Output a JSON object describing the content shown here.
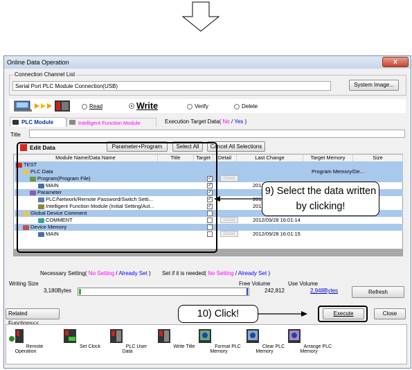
{
  "window": {
    "title": "Online Data Operation",
    "close_glyph": "x"
  },
  "connection": {
    "group_label": "Connection Channel List",
    "value": "Serial Port  PLC Module Connection(USB)",
    "system_image_label": "System Image..."
  },
  "operations": {
    "read": "Read",
    "write": "Write",
    "verify": "Verify",
    "delete": "Delete",
    "selected": "write"
  },
  "tabs": [
    {
      "label": "PLC Module"
    },
    {
      "label": "Intelligent Function Module"
    }
  ],
  "execution_target": {
    "label": "Execution Target Data(",
    "no": "No",
    "slash": "/",
    "yes": "Yes",
    "close": ")"
  },
  "title_field": {
    "label": "Title",
    "value": ""
  },
  "edit_data": {
    "label": "Edit Data",
    "param_program_btn": "Parameter+Program",
    "select_all_btn": "Select All",
    "cancel_btn": "Cancel All Selections"
  },
  "table": {
    "headers": [
      "Module Name/Data Name",
      "Title",
      "Target",
      "Detail",
      "Last Change",
      "Target Memory",
      "Size"
    ],
    "rows": [
      {
        "name": "TEST",
        "checked": false,
        "detail": "",
        "date": "",
        "memory": "",
        "blue": true
      },
      {
        "name": "PLC Data",
        "checked": false,
        "detail": "",
        "date": "",
        "memory": "Program Memory/De...",
        "blue": true
      },
      {
        "name": "Program(Program File)",
        "checked": true,
        "detail": "Detail",
        "date": "",
        "memory": "",
        "blue": true
      },
      {
        "name": "MAIN",
        "checked": true,
        "detail": "",
        "date": "2012/",
        "memory": "",
        "blue": false
      },
      {
        "name": "Parameter",
        "checked": true,
        "detail": "",
        "date": "",
        "memory": "",
        "blue": true
      },
      {
        "name": "PLC/Network/Remote Password/Switch Setti...",
        "checked": true,
        "detail": "",
        "date": "2012/",
        "memory": "",
        "blue": false
      },
      {
        "name": "Intelligent Function Module (Initial Setting/Aut...",
        "checked": true,
        "detail": "",
        "date": "2012/",
        "memory": "",
        "blue": false
      },
      {
        "name": "Global Device Comment",
        "checked": false,
        "detail": "",
        "date": "",
        "memory": "",
        "blue": true
      },
      {
        "name": "COMMENT",
        "checked": false,
        "detail": "Detail",
        "date": "2012/09/28 16:01:14",
        "memory": "",
        "blue": false
      },
      {
        "name": "Device Memory",
        "checked": false,
        "detail": "",
        "date": "",
        "memory": "",
        "blue": true
      },
      {
        "name": "MAIN",
        "checked": false,
        "detail": "Detail",
        "date": "2012/09/28 16:01:15",
        "memory": "",
        "blue": false
      }
    ]
  },
  "legend": {
    "necessary": "Necessary Setting(",
    "no_setting": "No Setting",
    "slash": "/",
    "already_set": "Already Set",
    "close": ")",
    "if_needed": "Set if it is needed(",
    "no_setting2": "No Setting",
    "already_set2": "Already Set"
  },
  "sizes": {
    "writing_size_label": "Writing Size",
    "writing_size_value": "3,180Bytes",
    "free_volume_label": "Free Volume",
    "free_volume_value": "242,812",
    "use_volume_label": "Use Volume",
    "use_volume_value": "2,948Bytes",
    "refresh_label": "Refresh"
  },
  "bottom": {
    "related_functions": "Related Functions<<",
    "execute": "Execute",
    "close": "Close"
  },
  "functions": [
    {
      "label": "Remote Operation"
    },
    {
      "label": "Set Clock"
    },
    {
      "label": "PLC User Data"
    },
    {
      "label": "Write Title"
    },
    {
      "label": "Format PLC Memory"
    },
    {
      "label": "Clear PLC Memory"
    },
    {
      "label": "Arrange PLC Memory"
    }
  ],
  "annotations": {
    "select_callout": "9) Select the data written by clicking!",
    "click_callout": "10) Click!"
  },
  "colors": {
    "selection_blue": "#a8c8ec",
    "magenta": "#ff00ff",
    "link_blue": "#0000ff",
    "brand_red": "#d9261c"
  }
}
